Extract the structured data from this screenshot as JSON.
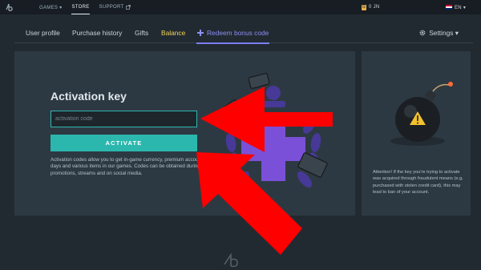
{
  "topbar": {
    "nav": [
      {
        "label": "GAMES ▾",
        "active": false
      },
      {
        "label": "STORE",
        "active": true
      },
      {
        "label": "SUPPORT",
        "active": false
      }
    ],
    "currency": "0 ЈN",
    "language": "EN ▾"
  },
  "subnav": {
    "tabs": [
      {
        "label": "User profile"
      },
      {
        "label": "Purchase history"
      },
      {
        "label": "Gifts"
      },
      {
        "label": "Balance"
      },
      {
        "label": "Redeem bonus code"
      }
    ],
    "settings_label": "Settings ▾"
  },
  "redeem": {
    "heading": "Activation key",
    "placeholder": "activation code",
    "button_label": "ACTIVATE",
    "description": "Activation codes allow you to get in-game currency, premium account days and various items in our games. Codes can be obtained during promotions, streams and on social media."
  },
  "side": {
    "warning": "Attention! If the key you're trying to activate was acquired through fraudulent means (e.g. purchased with stolen credit card), this may lead to ban of your account."
  },
  "colors": {
    "accent": "#2bb7ae",
    "active_tab": "#8b8ff0",
    "balance": "#f2d45c",
    "arrow": "#ff0000"
  },
  "icons": [
    "logo-icon",
    "external-link-icon",
    "coin-icon",
    "flag-icon",
    "redeem-icon",
    "gear-icon",
    "bomb-icon",
    "warning-icon",
    "arrow-annotation"
  ]
}
